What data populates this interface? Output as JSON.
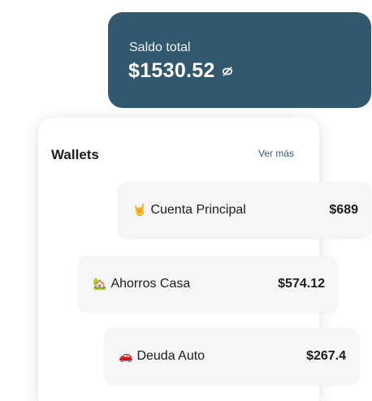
{
  "balance": {
    "label": "Saldo total",
    "amount": "$1530.52",
    "visibility_icon": "eye-off-icon"
  },
  "wallets": {
    "title": "Wallets",
    "see_more": "Ver más",
    "items": [
      {
        "emoji": "🤘",
        "name": "Cuenta Principal",
        "amount": "$689"
      },
      {
        "emoji": "🏡",
        "name": "Ahorros Casa",
        "amount": "$574.12"
      },
      {
        "emoji": "🚗",
        "name": "Deuda Auto",
        "amount": "$267.4"
      }
    ]
  },
  "colors": {
    "balance_card": "#32586e",
    "link": "#3a5e78",
    "wallet_card": "#f6f6f6"
  }
}
